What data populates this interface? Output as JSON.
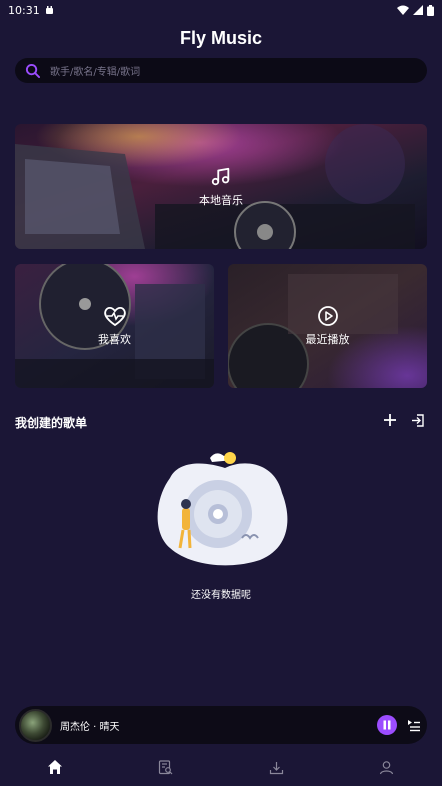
{
  "status": {
    "time": "10:31"
  },
  "header": {
    "title": "Fly Music"
  },
  "search": {
    "placeholder": "歌手/歌名/专辑/歌词"
  },
  "cards": {
    "local": {
      "label": "本地音乐"
    },
    "like": {
      "label": "我喜欢"
    },
    "recent": {
      "label": "最近播放"
    }
  },
  "playlists": {
    "title": "我创建的歌单",
    "empty_text": "还没有数据呢"
  },
  "player": {
    "song": "周杰伦 · 晴天"
  },
  "colors": {
    "background": "#1b1636",
    "accent": "#9c4dff",
    "search_bg": "#0c0a16"
  },
  "tabs": [
    {
      "icon": "home-icon",
      "active": true
    },
    {
      "icon": "playlist-search-icon",
      "active": false
    },
    {
      "icon": "download-icon",
      "active": false
    },
    {
      "icon": "profile-icon",
      "active": false
    }
  ]
}
